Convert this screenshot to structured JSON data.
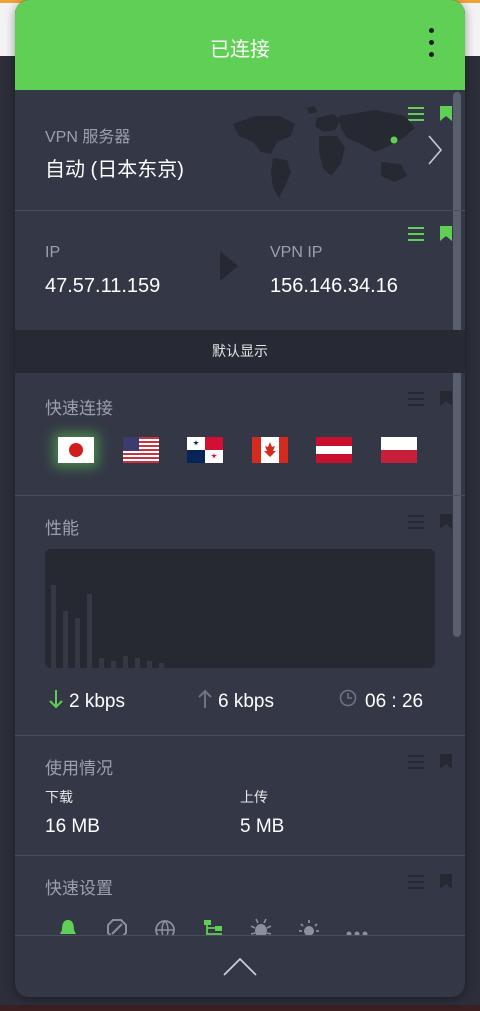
{
  "header": {
    "title": "已连接"
  },
  "server": {
    "label": "VPN 服务器",
    "value": "自动 (日本东京)"
  },
  "ip": {
    "ip_label": "IP",
    "ip_value": "47.57.11.159",
    "vpn_ip_label": "VPN IP",
    "vpn_ip_value": "156.146.34.16"
  },
  "default_bar": {
    "label": "默认显示"
  },
  "quick_connect": {
    "title": "快速连接",
    "flags": [
      "Japan",
      "USA",
      "Panama",
      "Canada",
      "Austria",
      "Poland"
    ]
  },
  "performance": {
    "title": "性能",
    "download": "2 kbps",
    "upload": "6 kbps",
    "time": "06 : 26",
    "graph_levels": [
      0.7,
      0.48,
      0.42,
      0.62,
      0.08,
      0.06,
      0.1,
      0.08,
      0.06,
      0.04
    ]
  },
  "usage": {
    "title": "使用情况",
    "download_label": "下载",
    "download_value": "16 MB",
    "upload_label": "上传",
    "upload_value": "5 MB"
  },
  "quick_settings": {
    "title": "快速设置",
    "icons": [
      "bell-icon",
      "block-icon",
      "globe-icon",
      "network-icon",
      "bug-icon",
      "sun-icon",
      "more-icon"
    ]
  },
  "colors": {
    "accent": "#5fcf55",
    "panel": "#343846",
    "text_grey": "#9aa0ad"
  }
}
